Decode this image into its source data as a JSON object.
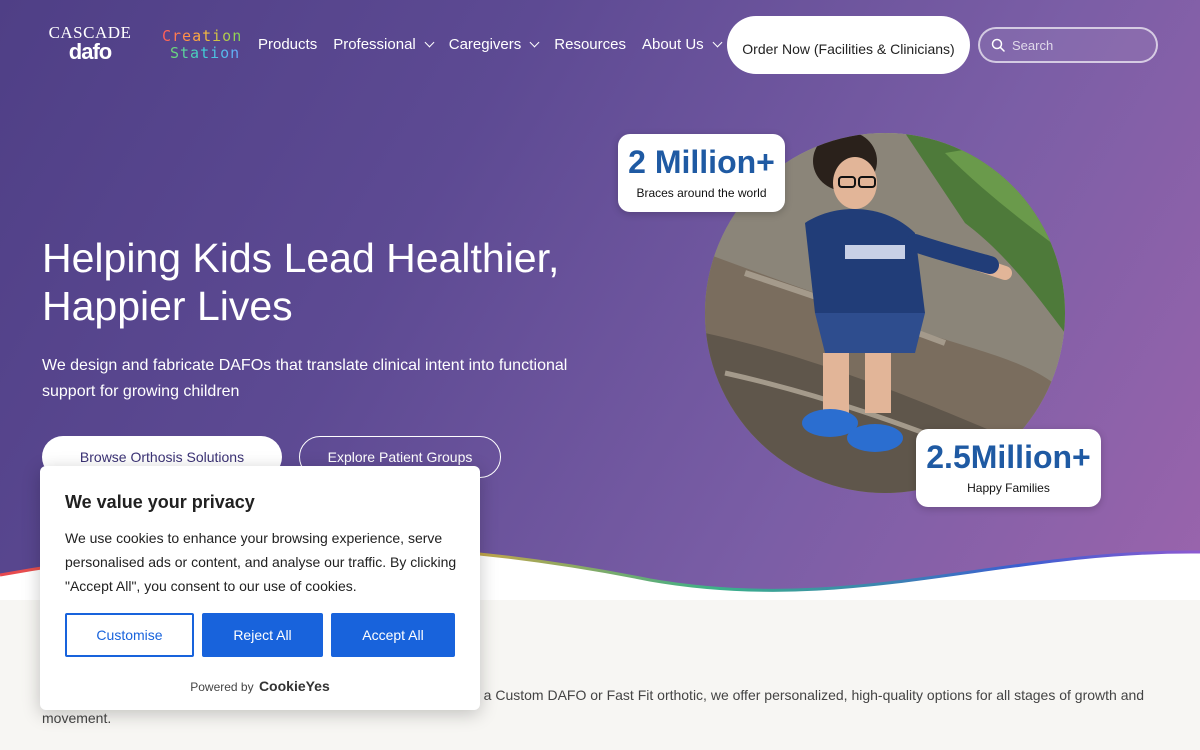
{
  "header": {
    "logo_line1": "CASCADE",
    "logo_line2": "dafo",
    "creation_word1": "Creation",
    "creation_word2": "Station",
    "nav": [
      {
        "label": "Products",
        "has_dropdown": false
      },
      {
        "label": "Professional",
        "has_dropdown": true
      },
      {
        "label": "Caregivers",
        "has_dropdown": true
      },
      {
        "label": "Resources",
        "has_dropdown": false
      },
      {
        "label": "About Us",
        "has_dropdown": true
      }
    ],
    "order_button": "Order Now (Facilities & Clinicians)",
    "search_placeholder": "Search"
  },
  "hero": {
    "title": "Helping Kids Lead Healthier, Happier Lives",
    "subtitle": "We design and fabricate DAFOs that translate clinical intent into functional support for growing children",
    "browse_button": "Browse Orthosis Solutions",
    "explore_button": "Explore Patient Groups",
    "stats": [
      {
        "value": "2 Million+",
        "label": "Braces around the world"
      },
      {
        "value": "2.5Million+",
        "label": "Happy Families"
      }
    ]
  },
  "below": {
    "text": "d a Custom DAFO or Fast Fit orthotic, we offer personalized, high-quality options for all stages of growth and movement."
  },
  "cookie": {
    "title": "We value your privacy",
    "body": "We use cookies to enhance your browsing experience, serve personalised ads or content, and analyse our traffic. By clicking \"Accept All\", you consent to our use of cookies.",
    "customise": "Customise",
    "reject": "Reject All",
    "accept": "Accept All",
    "powered_by": "Powered by",
    "powered_brand": "CookieYes"
  },
  "colors": {
    "hero_start": "#4f3f86",
    "hero_end": "#9a64ac",
    "stat_number": "#1f5aa3",
    "cookie_accent": "#1863dc"
  }
}
